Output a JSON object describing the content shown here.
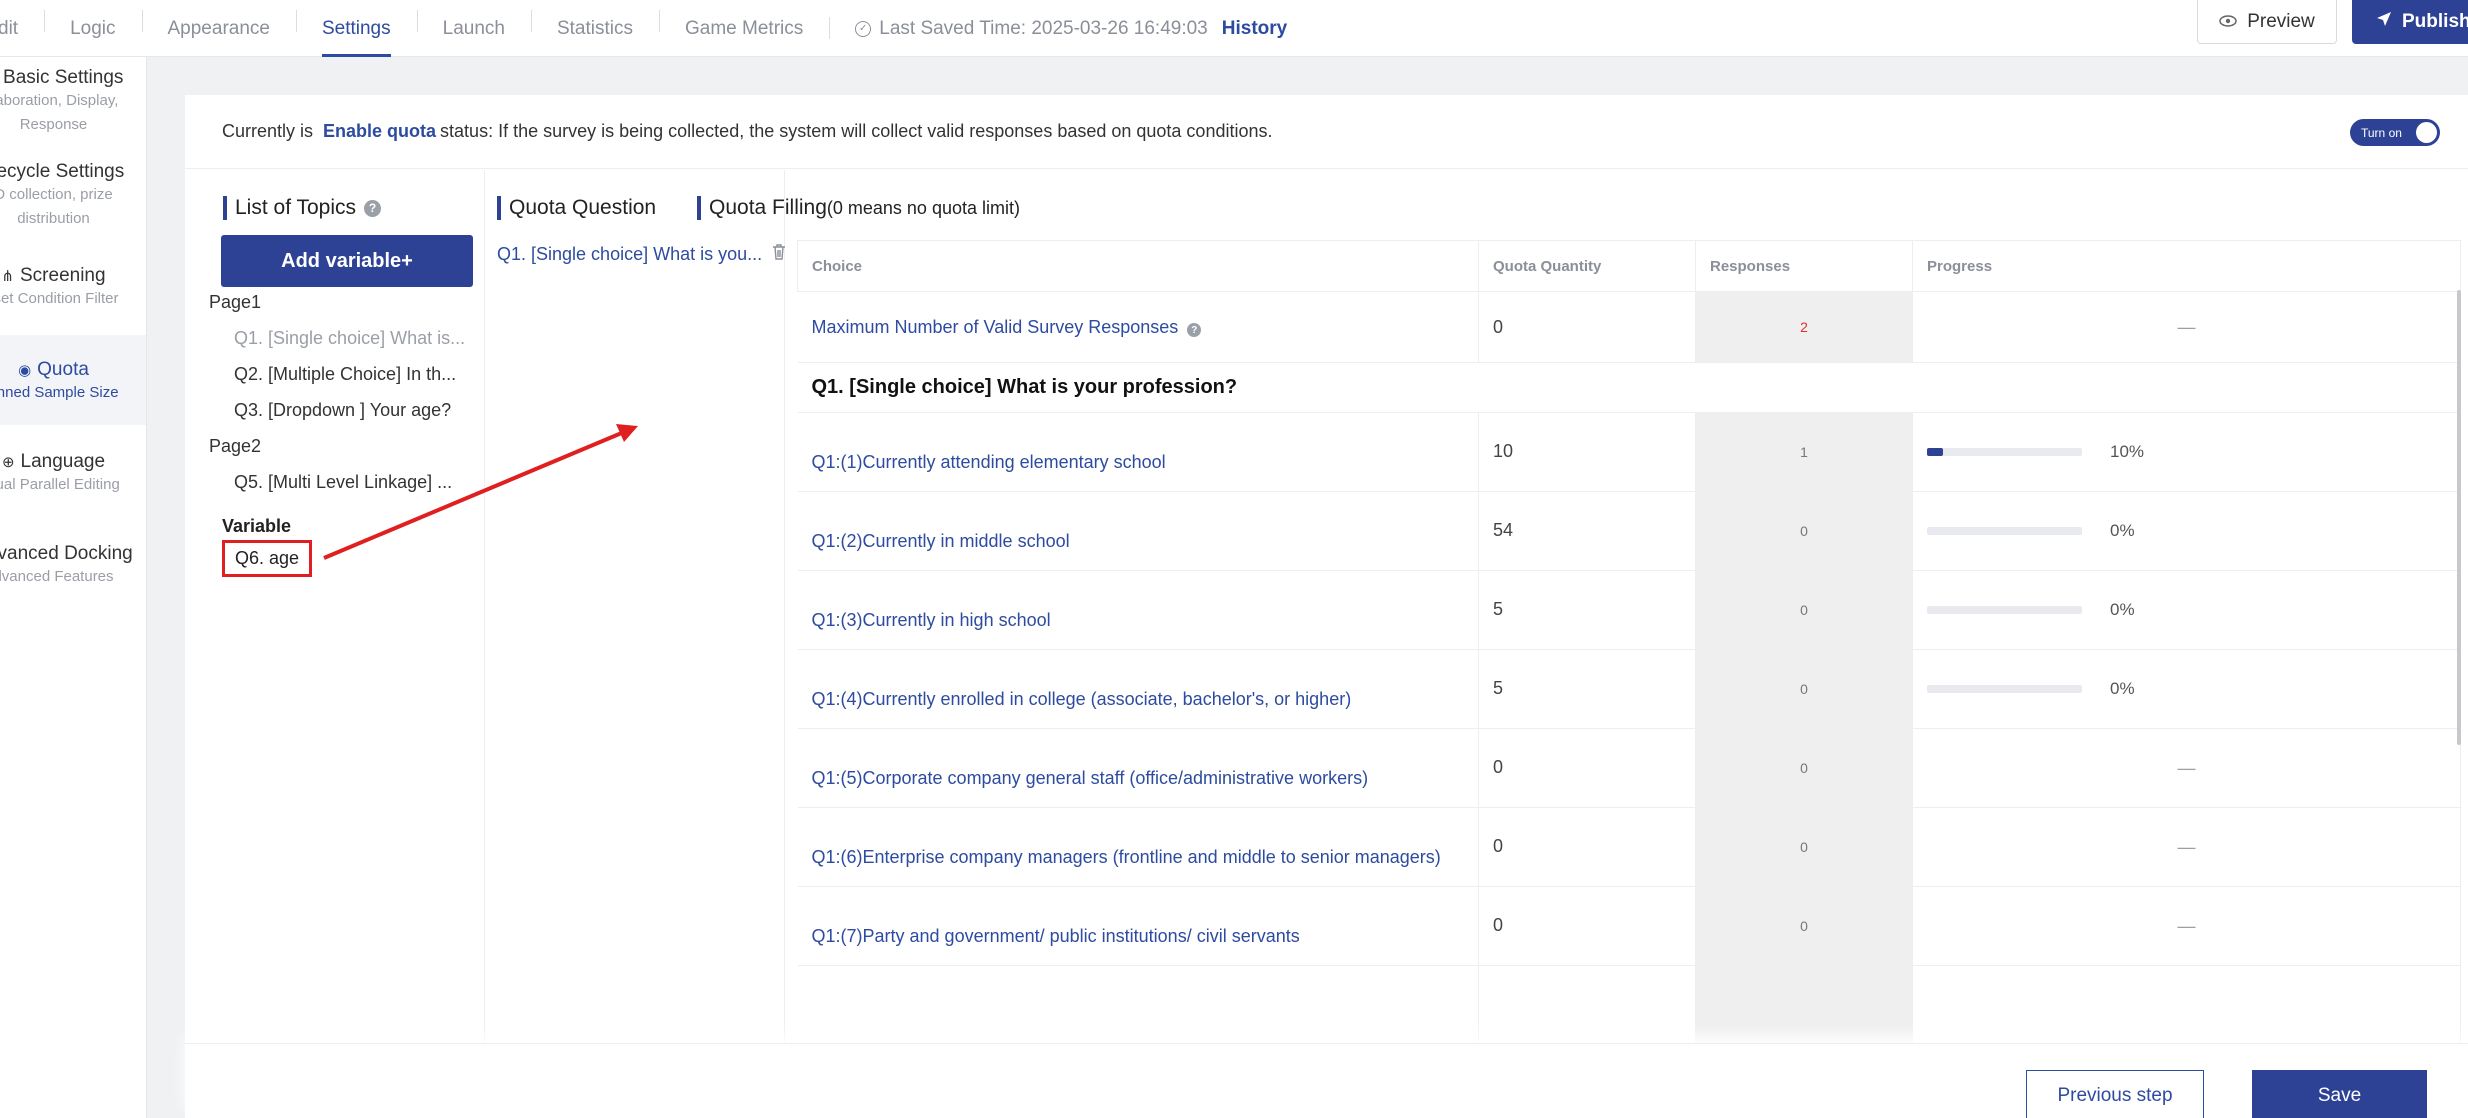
{
  "topbar": {
    "nav": [
      "dit",
      "Logic",
      "Appearance",
      "Settings",
      "Launch",
      "Statistics",
      "Game Metrics"
    ],
    "active_nav": "Settings",
    "saved_text": "Last Saved Time: 2025-03-26 16:49:03",
    "history": "History",
    "preview": "Preview",
    "publish": "Publish"
  },
  "sidebar": {
    "items": [
      {
        "title": "Basic Settings",
        "icon": "gear-icon",
        "sub": [
          "llaboration, Display,",
          "Response"
        ]
      },
      {
        "title": "Recycle Settings",
        "icon": "",
        "sub": [
          "D collection, prize",
          "distribution"
        ]
      },
      {
        "title": "Screening",
        "icon": "filter-tree-icon",
        "sub": [
          "-set Condition Filter"
        ]
      },
      {
        "title": "Quota",
        "icon": "user-circle-icon",
        "sub": [
          "anned Sample Size"
        ],
        "active": true
      },
      {
        "title": "Language",
        "icon": "globe-icon",
        "sub": [
          "gual Parallel Editing"
        ]
      },
      {
        "title": "Advanced Docking",
        "icon": "",
        "sub": [
          "dvanced Features"
        ]
      }
    ]
  },
  "status": {
    "prefix": "Currently is",
    "highlight": "Enable quota",
    "suffix": "status: If the survey is being collected, the system will collect valid responses based on quota conditions.",
    "toggle_label": "Turn on"
  },
  "topics": {
    "title": "List of Topics",
    "add_variable": "Add variable+",
    "page1": "Page1",
    "q1": "Q1. [Single choice] What is...",
    "q2": "Q2. [Multiple Choice] In th...",
    "q3": "Q3. [Dropdown ] Your age?",
    "page2": "Page2",
    "q5": "Q5. [Multi Level Linkage] ...",
    "variable_label": "Variable",
    "variable_item": "Q6. age"
  },
  "quota_question": {
    "title": "Quota Question",
    "item": "Q1. [Single choice] What is you..."
  },
  "quota_filling": {
    "title": "Quota Filling",
    "subtitle": "(0 means no quota limit)",
    "headers": {
      "choice": "Choice",
      "quantity": "Quota Quantity",
      "responses": "Responses",
      "progress": "Progress"
    },
    "max_row": {
      "choice": "Maximum Number of Valid Survey Responses",
      "quantity": "0",
      "responses": "2",
      "progress": "—"
    },
    "section": "Q1. [Single choice] What is your profession?",
    "rows": [
      {
        "choice": "Q1:(1)Currently attending elementary school",
        "quantity": "10",
        "responses": "1",
        "progress": "10%",
        "progress_value": 0.1
      },
      {
        "choice": "Q1:(2)Currently in middle school",
        "quantity": "54",
        "responses": "0",
        "progress": "0%",
        "progress_value": 0
      },
      {
        "choice": "Q1:(3)Currently in high school",
        "quantity": "5",
        "responses": "0",
        "progress": "0%",
        "progress_value": 0
      },
      {
        "choice": "Q1:(4)Currently enrolled in college (associate, bachelor's, or higher)",
        "quantity": "5",
        "responses": "0",
        "progress": "0%",
        "progress_value": 0
      },
      {
        "choice": "Q1:(5)Corporate company general staff (office/administrative workers)",
        "quantity": "0",
        "responses": "0",
        "progress": "—"
      },
      {
        "choice": "Q1:(6)Enterprise company managers (frontline and middle to senior managers)",
        "quantity": "0",
        "responses": "0",
        "progress": "—"
      },
      {
        "choice": "Q1:(7)Party and government/ public institutions/ civil servants",
        "quantity": "0",
        "responses": "0",
        "progress": "—"
      }
    ]
  },
  "actions": {
    "previous": "Previous step",
    "save": "Save"
  },
  "colors": {
    "accent": "#2d4295",
    "link": "#2d4ba0",
    "highlight_box": "#e02020"
  }
}
